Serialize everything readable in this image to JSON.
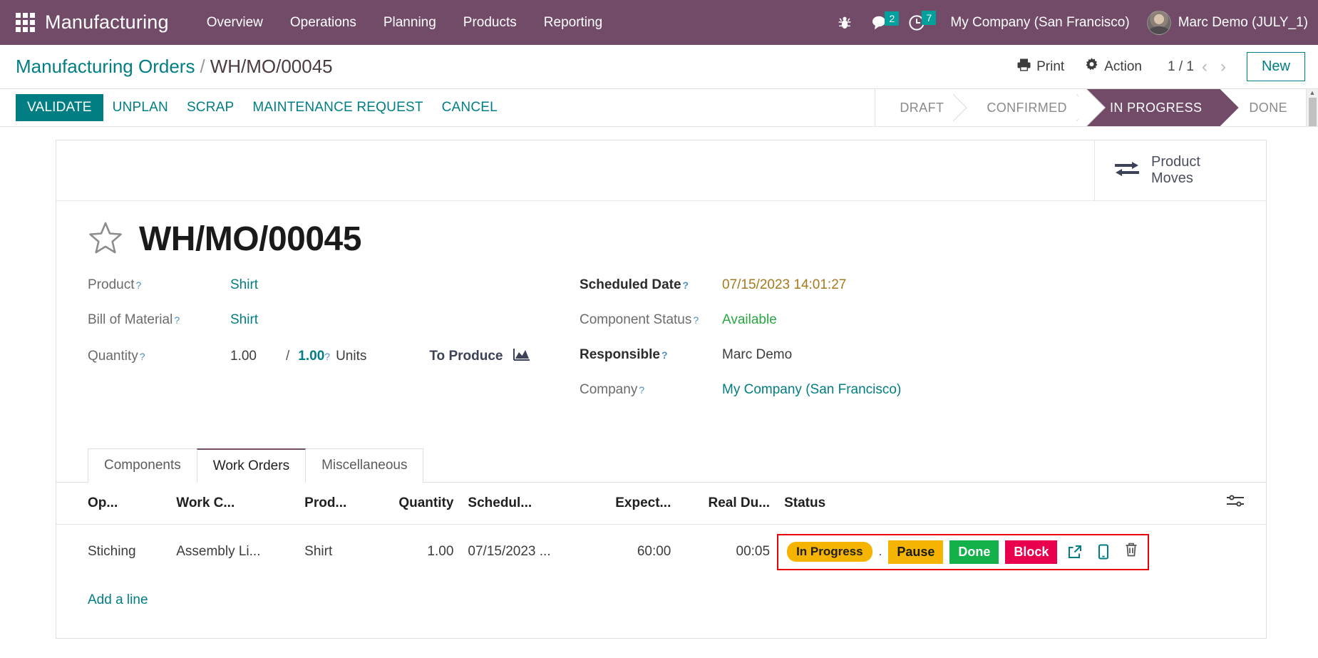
{
  "navbar": {
    "apps_icon": "apps-grid-icon",
    "brand": "Manufacturing",
    "menu": [
      {
        "label": "Overview"
      },
      {
        "label": "Operations"
      },
      {
        "label": "Planning"
      },
      {
        "label": "Products"
      },
      {
        "label": "Reporting"
      }
    ],
    "bug_icon": "bug-icon",
    "messages": {
      "icon": "chat-icon",
      "count": "2"
    },
    "activities": {
      "icon": "clock-icon",
      "count": "7"
    },
    "company": "My Company (San Francisco)",
    "user": "Marc Demo (JULY_1)",
    "bg_color": "#714B67",
    "badge_color": "#00A09D"
  },
  "control_panel": {
    "breadcrumb_root": "Manufacturing Orders",
    "breadcrumb_sep": "/",
    "breadcrumb_current": "WH/MO/00045",
    "print_label": "Print",
    "print_icon": "printer-icon",
    "action_label": "Action",
    "action_icon": "gear-icon",
    "pager": "1 / 1",
    "prev_icon": "chevron-left-icon",
    "next_icon": "chevron-right-icon",
    "new_label": "New"
  },
  "statusbar": {
    "buttons": [
      {
        "label": "VALIDATE",
        "primary": true
      },
      {
        "label": "UNPLAN",
        "primary": false
      },
      {
        "label": "SCRAP",
        "primary": false
      },
      {
        "label": "MAINTENANCE REQUEST",
        "primary": false
      },
      {
        "label": "CANCEL",
        "primary": false
      }
    ],
    "stages": [
      {
        "label": "DRAFT",
        "active": false
      },
      {
        "label": "CONFIRMED",
        "active": false
      },
      {
        "label": "IN PROGRESS",
        "active": true
      },
      {
        "label": "DONE",
        "active": false
      }
    ],
    "accent_color": "#017e84",
    "active_stage_color": "#714B67"
  },
  "stat_buttons": [
    {
      "icon": "exchange-arrows-icon",
      "line1": "Product",
      "line2": "Moves"
    }
  ],
  "record": {
    "favorite_icon": "star-outline-icon",
    "title": "WH/MO/00045",
    "left_fields": [
      {
        "label": "Product",
        "help": "?",
        "value": "Shirt",
        "style": "link"
      },
      {
        "label": "Bill of Material",
        "help": "?",
        "value": "Shirt",
        "style": "link"
      }
    ],
    "quantity": {
      "label": "Quantity",
      "help": "?",
      "produced": "1.00",
      "separator": "/",
      "to_produce": "1.00",
      "uom_help": "?",
      "uom": "Units",
      "forecast_label": "To Produce",
      "forecast_icon": "area-chart-icon"
    },
    "right_fields": [
      {
        "label": "Scheduled Date",
        "help": "?",
        "value": "07/15/2023 14:01:27",
        "style": "date",
        "bold_label": true
      },
      {
        "label": "Component Status",
        "help": "?",
        "value": "Available",
        "style": "green",
        "bold_label": false
      },
      {
        "label": "Responsible",
        "help": "?",
        "value": "Marc Demo",
        "style": "plain",
        "bold_label": true
      },
      {
        "label": "Company",
        "help": "?",
        "value": "My Company (San Francisco)",
        "style": "link",
        "bold_label": false
      }
    ]
  },
  "notebook": {
    "tabs": [
      {
        "label": "Components",
        "active": false
      },
      {
        "label": "Work Orders",
        "active": true
      },
      {
        "label": "Miscellaneous",
        "active": false
      }
    ],
    "table": {
      "columns": [
        {
          "label": "Op...",
          "align": "left"
        },
        {
          "label": "Work C...",
          "align": "left"
        },
        {
          "label": "Prod...",
          "align": "left"
        },
        {
          "label": "Quantity",
          "align": "right"
        },
        {
          "label": "Schedul...",
          "align": "left"
        },
        {
          "label": "Expect...",
          "align": "right"
        },
        {
          "label": "Real Du...",
          "align": "right"
        },
        {
          "label": "Status",
          "align": "left"
        }
      ],
      "optional_columns_icon": "settings-sliders-icon",
      "rows": [
        {
          "operation": "Stiching",
          "work_center": "Assembly Li...",
          "product": "Shirt",
          "quantity": "1.00",
          "scheduled": "07/15/2023 ...",
          "expected_duration": "60:00",
          "real_duration": "00:05",
          "status_pill": "In Progress",
          "status_sep": ".",
          "buttons": [
            {
              "label": "Pause",
              "kind": "pause"
            },
            {
              "label": "Done",
              "kind": "done"
            },
            {
              "label": "Block",
              "kind": "block"
            }
          ],
          "open_icon": "external-link-icon",
          "tablet_icon": "tablet-icon",
          "delete_icon": "trash-icon"
        }
      ],
      "add_line_label": "Add a line",
      "highlight_color": "#e8000a"
    }
  }
}
